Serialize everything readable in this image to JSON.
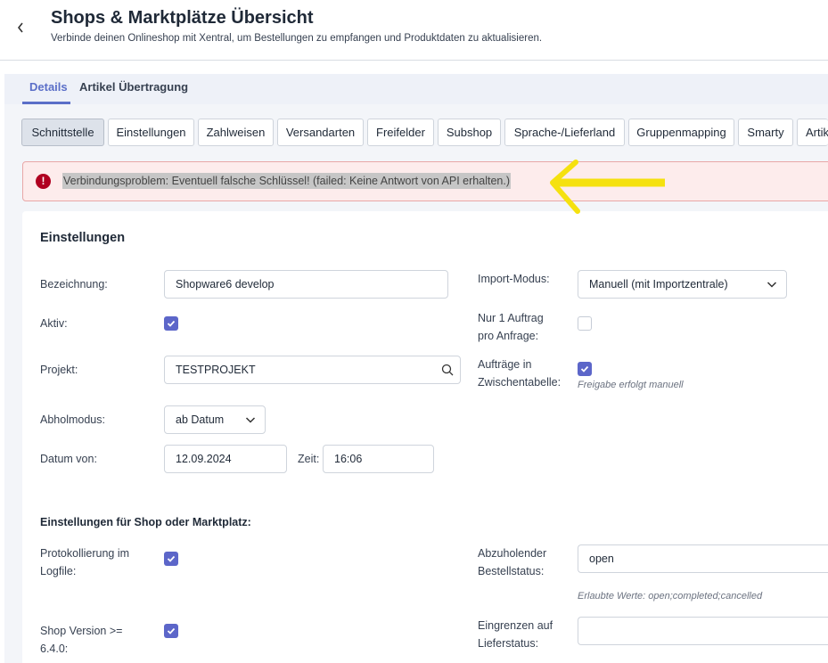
{
  "header": {
    "back_icon": "chevron-left-icon",
    "title": "Shops & Marktplätze Übersicht",
    "subtitle": "Verbinde deinen Onlineshop mit Xentral, um Bestellungen zu empfangen und Produktdaten zu aktualisieren."
  },
  "tabs": [
    "Details",
    "Artikel Übertragung"
  ],
  "subtabs": [
    "Schnittstelle",
    "Einstellungen",
    "Zahlweisen",
    "Versandarten",
    "Freifelder",
    "Subshop",
    "Sprache-/Lieferland",
    "Gruppenmapping",
    "Smarty",
    "Artikel"
  ],
  "alert": {
    "icon": "error-icon",
    "text": "Verbindungsproblem: Eventuell falsche Schlüssel! (failed: Keine Antwort von API erhalten.)",
    "annotation_color": "#f5e10f"
  },
  "settings": {
    "title": "Einstellungen",
    "bezeichnung": {
      "label": "Bezeichnung:",
      "value": "Shopware6 develop"
    },
    "aktiv": {
      "label": "Aktiv:",
      "checked": true
    },
    "projekt": {
      "label": "Projekt:",
      "value": "TESTPROJEKT"
    },
    "abholmodus": {
      "label": "Abholmodus:",
      "value": "ab Datum"
    },
    "datum_von": {
      "label": "Datum von:",
      "value": "12.09.2024"
    },
    "zeit": {
      "label": "Zeit:",
      "value": "16:06"
    },
    "import_modus": {
      "label": "Import-Modus:",
      "value": "Manuell (mit Importzentrale)"
    },
    "nur_ein_auftrag": {
      "label_1": "Nur 1 Auftrag",
      "label_2": "pro Anfrage:",
      "checked": false
    },
    "auftraege_zwischentabelle": {
      "label_1": "Aufträge in",
      "label_2": "Zwischentabelle:",
      "checked": true,
      "hint": "Freigabe erfolgt manuell"
    }
  },
  "shop_settings": {
    "title": "Einstellungen für Shop oder Marktplatz:",
    "protokollierung": {
      "label_1": "Protokollierung im",
      "label_2": "Logfile:",
      "checked": true
    },
    "shop_version": {
      "label_1": "Shop Version >=",
      "label_2": "6.4.0:",
      "checked": true
    },
    "bestellstatus": {
      "label_1": "Abzuholender",
      "label_2": "Bestellstatus:",
      "value": "open",
      "hint": "Erlaubte Werte: open;completed;cancelled"
    },
    "lieferstatus": {
      "label_1": "Eingrenzen auf",
      "label_2": "Lieferstatus:",
      "value": ""
    }
  },
  "colors": {
    "accent": "#5c66c9",
    "alert_bg": "#fdecec",
    "alert_icon": "#b00020"
  }
}
